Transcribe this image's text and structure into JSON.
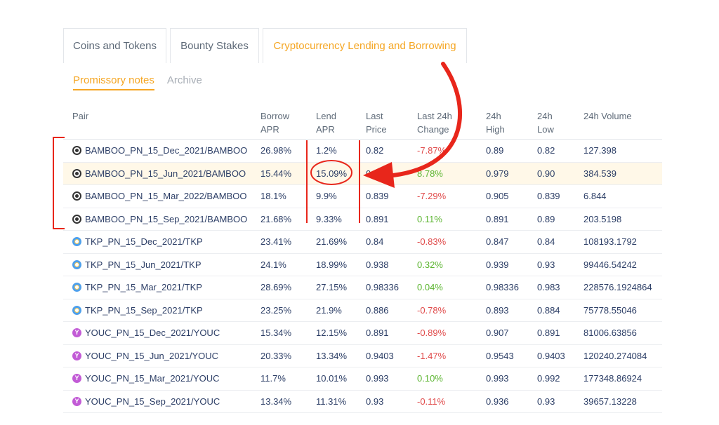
{
  "tabs": [
    "Coins and Tokens",
    "Bounty Stakes",
    "Cryptocurrency Lending and Borrowing"
  ],
  "subtabs": [
    "Promissory notes",
    "Archive"
  ],
  "columns": {
    "pair": "Pair",
    "borrow_apr": "Borrow\nAPR",
    "lend_apr": "Lend\nAPR",
    "last_price": "Last\nPrice",
    "change": "Last 24h\nChange",
    "high": "24h\nHigh",
    "low": "24h\nLow",
    "volume": "24h Volume"
  },
  "rows": [
    {
      "pair": "BAMBOO_PN_15_Dec_2021/BAMBOO",
      "borrow": "26.98%",
      "lend": "1.2%",
      "last": "0.82",
      "change": "-7.87%",
      "high": "0.89",
      "low": "0.82",
      "volume": "127.398"
    },
    {
      "pair": "BAMBOO_PN_15_Jun_2021/BAMBOO",
      "borrow": "15.44%",
      "lend": "15.09%",
      "last": "0.9",
      "change": "8.78%",
      "high": "0.979",
      "low": "0.90",
      "volume": "384.539"
    },
    {
      "pair": "BAMBOO_PN_15_Mar_2022/BAMBOO",
      "borrow": "18.1%",
      "lend": "9.9%",
      "last": "0.839",
      "change": "-7.29%",
      "high": "0.905",
      "low": "0.839",
      "volume": "6.844"
    },
    {
      "pair": "BAMBOO_PN_15_Sep_2021/BAMBOO",
      "borrow": "21.68%",
      "lend": "9.33%",
      "last": "0.891",
      "change": "0.11%",
      "high": "0.891",
      "low": "0.89",
      "volume": "203.5198"
    },
    {
      "pair": "TKP_PN_15_Dec_2021/TKP",
      "borrow": "23.41%",
      "lend": "21.69%",
      "last": "0.84",
      "change": "-0.83%",
      "high": "0.847",
      "low": "0.84",
      "volume": "108193.1792"
    },
    {
      "pair": "TKP_PN_15_Jun_2021/TKP",
      "borrow": "24.1%",
      "lend": "18.99%",
      "last": "0.938",
      "change": "0.32%",
      "high": "0.939",
      "low": "0.93",
      "volume": "99446.54242"
    },
    {
      "pair": "TKP_PN_15_Mar_2021/TKP",
      "borrow": "28.69%",
      "lend": "27.15%",
      "last": "0.98336",
      "change": "0.04%",
      "high": "0.98336",
      "low": "0.983",
      "volume": "228576.1924864"
    },
    {
      "pair": "TKP_PN_15_Sep_2021/TKP",
      "borrow": "23.25%",
      "lend": "21.9%",
      "last": "0.886",
      "change": "-0.78%",
      "high": "0.893",
      "low": "0.884",
      "volume": "75778.55046"
    },
    {
      "pair": "YOUC_PN_15_Dec_2021/YOUC",
      "borrow": "15.34%",
      "lend": "12.15%",
      "last": "0.891",
      "change": "-0.89%",
      "high": "0.907",
      "low": "0.891",
      "volume": "81006.63856"
    },
    {
      "pair": "YOUC_PN_15_Jun_2021/YOUC",
      "borrow": "20.33%",
      "lend": "13.34%",
      "last": "0.9403",
      "change": "-1.47%",
      "high": "0.9543",
      "low": "0.9403",
      "volume": "120240.274084"
    },
    {
      "pair": "YOUC_PN_15_Mar_2021/YOUC",
      "borrow": "11.7%",
      "lend": "10.01%",
      "last": "0.993",
      "change": "0.10%",
      "high": "0.993",
      "low": "0.992",
      "volume": "177348.86924"
    },
    {
      "pair": "YOUC_PN_15_Sep_2021/YOUC",
      "borrow": "13.34%",
      "lend": "11.31%",
      "last": "0.93",
      "change": "-0.11%",
      "high": "0.936",
      "low": "0.93",
      "volume": "39657.13228"
    }
  ],
  "colors": {
    "accent": "#f5a623",
    "negative": "#e04a4a",
    "positive": "#5cb531",
    "annotation": "#e8261b",
    "highlight_row": "#fff8e8"
  },
  "icons": [
    "panda-icon",
    "tkp-coin-icon",
    "youc-coin-icon"
  ]
}
